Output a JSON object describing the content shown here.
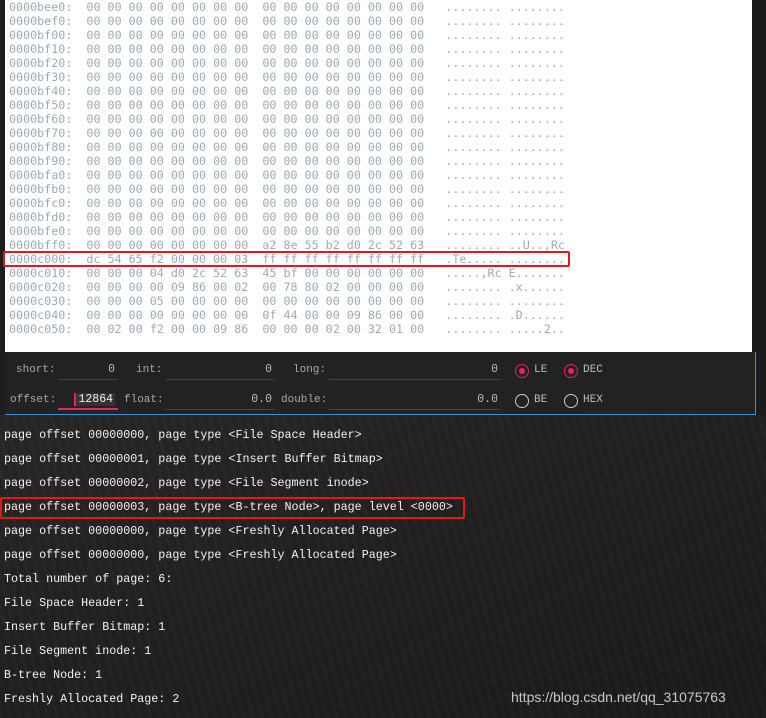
{
  "hex_view": {
    "rows": [
      {
        "addr": "0000bee0:",
        "hex1": "00 00 00 00 00 00 00 00",
        "hex2": "00 00 00 00 00 00 00 00",
        "ascii": "........ ........"
      },
      {
        "addr": "0000bef0:",
        "hex1": "00 00 00 00 00 00 00 00",
        "hex2": "00 00 00 00 00 00 00 00",
        "ascii": "........ ........"
      },
      {
        "addr": "0000bf00:",
        "hex1": "00 00 00 00 00 00 00 00",
        "hex2": "00 00 00 00 00 00 00 00",
        "ascii": "........ ........"
      },
      {
        "addr": "0000bf10:",
        "hex1": "00 00 00 00 00 00 00 00",
        "hex2": "00 00 00 00 00 00 00 00",
        "ascii": "........ ........"
      },
      {
        "addr": "0000bf20:",
        "hex1": "00 00 00 00 00 00 00 00",
        "hex2": "00 00 00 00 00 00 00 00",
        "ascii": "........ ........"
      },
      {
        "addr": "0000bf30:",
        "hex1": "00 00 00 00 00 00 00 00",
        "hex2": "00 00 00 00 00 00 00 00",
        "ascii": "........ ........"
      },
      {
        "addr": "0000bf40:",
        "hex1": "00 00 00 00 00 00 00 00",
        "hex2": "00 00 00 00 00 00 00 00",
        "ascii": "........ ........"
      },
      {
        "addr": "0000bf50:",
        "hex1": "00 00 00 00 00 00 00 00",
        "hex2": "00 00 00 00 00 00 00 00",
        "ascii": "........ ........"
      },
      {
        "addr": "0000bf60:",
        "hex1": "00 00 00 00 00 00 00 00",
        "hex2": "00 00 00 00 00 00 00 00",
        "ascii": "........ ........"
      },
      {
        "addr": "0000bf70:",
        "hex1": "00 00 00 00 00 00 00 00",
        "hex2": "00 00 00 00 00 00 00 00",
        "ascii": "........ ........"
      },
      {
        "addr": "0000bf80:",
        "hex1": "00 00 00 00 00 00 00 00",
        "hex2": "00 00 00 00 00 00 00 00",
        "ascii": "........ ........"
      },
      {
        "addr": "0000bf90:",
        "hex1": "00 00 00 00 00 00 00 00",
        "hex2": "00 00 00 00 00 00 00 00",
        "ascii": "........ ........"
      },
      {
        "addr": "0000bfa0:",
        "hex1": "00 00 00 00 00 00 00 00",
        "hex2": "00 00 00 00 00 00 00 00",
        "ascii": "........ ........"
      },
      {
        "addr": "0000bfb0:",
        "hex1": "00 00 00 00 00 00 00 00",
        "hex2": "00 00 00 00 00 00 00 00",
        "ascii": "........ ........"
      },
      {
        "addr": "0000bfc0:",
        "hex1": "00 00 00 00 00 00 00 00",
        "hex2": "00 00 00 00 00 00 00 00",
        "ascii": "........ ........"
      },
      {
        "addr": "0000bfd0:",
        "hex1": "00 00 00 00 00 00 00 00",
        "hex2": "00 00 00 00 00 00 00 00",
        "ascii": "........ ........"
      },
      {
        "addr": "0000bfe0:",
        "hex1": "00 00 00 00 00 00 00 00",
        "hex2": "00 00 00 00 00 00 00 00",
        "ascii": "........ ........"
      },
      {
        "addr": "0000bff0:",
        "hex1": "00 00 00 00 00 00 00 00",
        "hex2": "a2 8e 55 b2 d0 2c 52 63",
        "ascii": "........ ..U..,Rc"
      },
      {
        "addr": "0000c000:",
        "hex1": "dc 54 65 f2 00 00 00 03",
        "hex2": "ff ff ff ff ff ff ff ff",
        "ascii": ".Te..... ........"
      },
      {
        "addr": "0000c010:",
        "hex1": "00 00 00 04 d0 2c 52 63",
        "hex2": "45 bf 00 00 00 00 00 00",
        "ascii": ".....,Rc E......."
      },
      {
        "addr": "0000c020:",
        "hex1": "00 00 00 00 09 86 00 02",
        "hex2": "00 78 80 02 00 00 00 00",
        "ascii": "........ .x......"
      },
      {
        "addr": "0000c030:",
        "hex1": "00 00 00 05 00 00 00 00",
        "hex2": "00 00 00 00 00 00 00 00",
        "ascii": "........ ........"
      },
      {
        "addr": "0000c040:",
        "hex1": "00 00 00 00 00 00 00 00",
        "hex2": "0f 44 00 00 09 86 00 00",
        "ascii": "........ .D......"
      },
      {
        "addr": "0000c050:",
        "hex1": "00 02 00 f2 00 00 09 86",
        "hex2": "00 00 00 02 00 32 01 00",
        "ascii": "........ .....2.."
      }
    ],
    "highlighted_row": "0000c000:"
  },
  "inspector": {
    "short_label": "short:",
    "short_value": "0",
    "int_label": "int:",
    "int_value": "0",
    "long_label": "long:",
    "long_value": "0",
    "offset_label": "offset:",
    "offset_value": "12864",
    "float_label": "float:",
    "float_value": "0.0",
    "double_label": "double:",
    "double_value": "0.0",
    "endian": {
      "le": "LE",
      "be": "BE",
      "selected": "LE"
    },
    "base": {
      "dec": "DEC",
      "hex": "HEX",
      "selected": "DEC"
    },
    "accent": "#e8245d"
  },
  "console": {
    "lines": [
      "page offset 00000000, page type <File Space Header>",
      "page offset 00000001, page type <Insert Buffer Bitmap>",
      "page offset 00000002, page type <File Segment inode>",
      "page offset 00000003, page type <B-tree Node>, page level <0000>",
      "page offset 00000000, page type <Freshly Allocated Page>",
      "page offset 00000000, page type <Freshly Allocated Page>",
      "Total number of page: 6:",
      "File Space Header: 1",
      "Insert Buffer Bitmap: 1",
      "File Segment inode: 1",
      "B-tree Node: 1",
      "Freshly Allocated Page: 2"
    ],
    "highlighted_line": 3
  },
  "watermark": "https://blog.csdn.net/qq_31075763",
  "highlight_color": "#e8161a"
}
